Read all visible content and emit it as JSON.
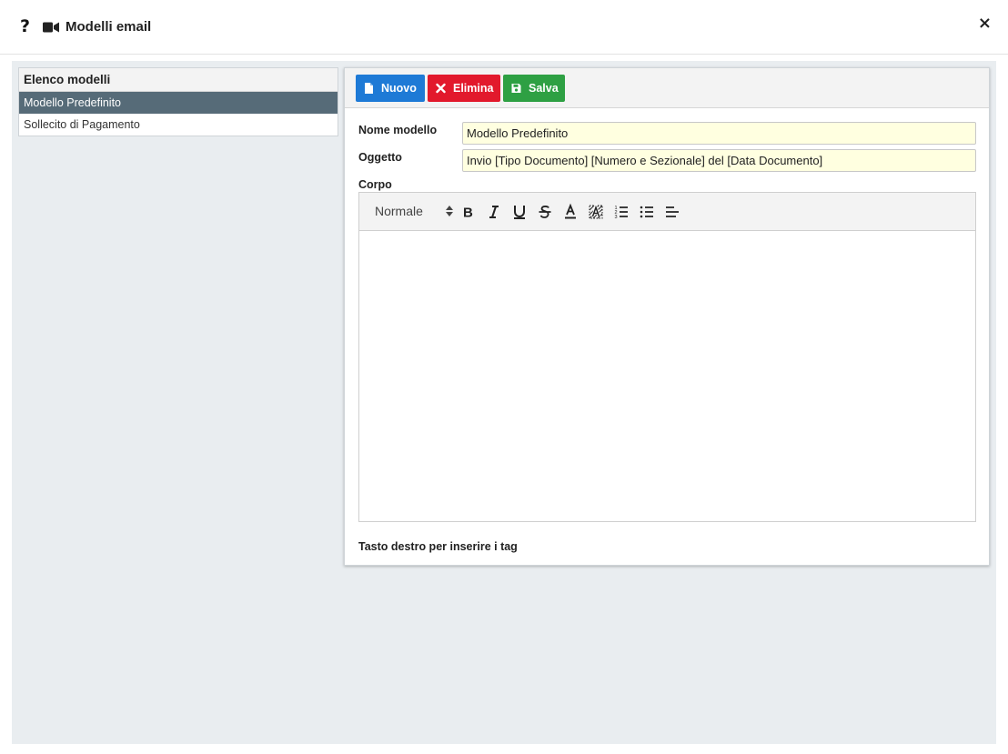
{
  "header": {
    "help_icon": "?",
    "camera_icon": "video-camera-icon",
    "title": "Modelli email",
    "close_icon": "×"
  },
  "template_list": {
    "heading": "Elenco modelli",
    "items": [
      {
        "label": "Modello Predefinito",
        "selected": true
      },
      {
        "label": "Sollecito di Pagamento",
        "selected": false
      }
    ]
  },
  "toolbar": {
    "new_label": "Nuovo",
    "delete_label": "Elimina",
    "save_label": "Salva",
    "colors": {
      "new": "#1e7ad6",
      "delete": "#e2192c",
      "save": "#2ea043"
    }
  },
  "form": {
    "name_label": "Nome modello",
    "name_value": "Modello Predefinito",
    "subject_label": "Oggetto",
    "subject_value": "Invio [Tipo Documento] [Numero e Sezionale] del [Data Documento]",
    "body_label": "Corpo",
    "editor": {
      "format_select": "Normale",
      "tools": [
        "bold-icon",
        "italic-icon",
        "underline-icon",
        "strikethrough-icon",
        "text-color-icon",
        "background-color-icon",
        "ordered-list-icon",
        "bullet-list-icon",
        "align-left-icon"
      ]
    },
    "hint": "Tasto destro per inserire i tag"
  },
  "colors": {
    "selected_item": "#566b78",
    "input_background": "#ffffe0",
    "workspace_background": "#e9edf0"
  }
}
